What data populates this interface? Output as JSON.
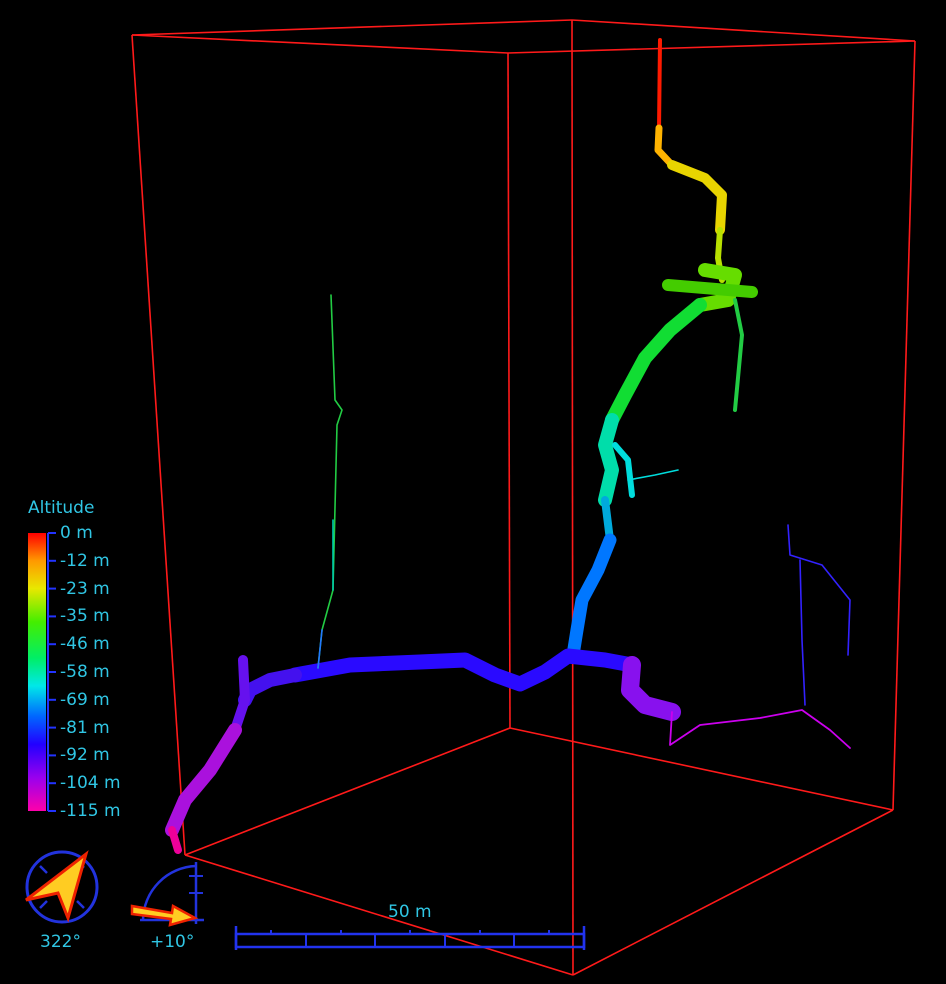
{
  "legend": {
    "title": "Altitude",
    "ticks": [
      "0 m",
      "-12 m",
      "-23 m",
      "-35 m",
      "-46 m",
      "-58 m",
      "-69 m",
      "-81 m",
      "-92 m",
      "-104 m",
      "-115 m"
    ]
  },
  "compass": {
    "heading": "322°"
  },
  "inclination": {
    "value": "+10°"
  },
  "scalebar": {
    "label": "50 m"
  },
  "colors": {
    "box": "#ff1a1a",
    "text": "#30c6e4",
    "widget_blue": "#2222dd",
    "arrow_yellow": "#ffcc22",
    "arrow_red": "#ee2200"
  }
}
